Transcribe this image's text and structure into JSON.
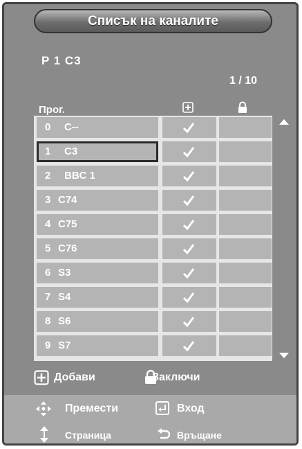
{
  "title": "Списък на каналите",
  "current_channel": "P  1  C3",
  "page_indicator": "1 / 10",
  "columns": {
    "prog": "Прог."
  },
  "channels": [
    {
      "num": "0",
      "name": "C--",
      "added": true
    },
    {
      "num": "1",
      "name": "C3",
      "added": true,
      "selected": true
    },
    {
      "num": "2",
      "name": "BBC 1",
      "added": true
    },
    {
      "num": "3",
      "name": "C74",
      "added": true
    },
    {
      "num": "4",
      "name": "C75",
      "added": true
    },
    {
      "num": "5",
      "name": "C76",
      "added": true
    },
    {
      "num": "6",
      "name": "S3",
      "added": true
    },
    {
      "num": "7",
      "name": "S4",
      "added": true
    },
    {
      "num": "8",
      "name": "S6",
      "added": true
    },
    {
      "num": "9",
      "name": "S7",
      "added": true
    }
  ],
  "legend": {
    "add": "Добави",
    "lock": "Заключи"
  },
  "footer": {
    "move": "Премести",
    "enter": "Вход",
    "page": "Страница",
    "return": "Връщане"
  },
  "colors": {
    "panel": "#8a8a8a",
    "cell": "#b4b4b4",
    "grid": "#e6e6e6",
    "footer": "#a9a9a9"
  },
  "icons": {
    "add": "add-box-icon",
    "lock": "padlock-icon",
    "check": "check-icon",
    "move": "four-way-arrows-icon",
    "enter": "enter-icon",
    "page": "up-down-arrows-icon",
    "return": "return-icon",
    "scroll_up": "scroll-up-arrow-icon",
    "scroll_down": "scroll-down-arrow-icon"
  }
}
